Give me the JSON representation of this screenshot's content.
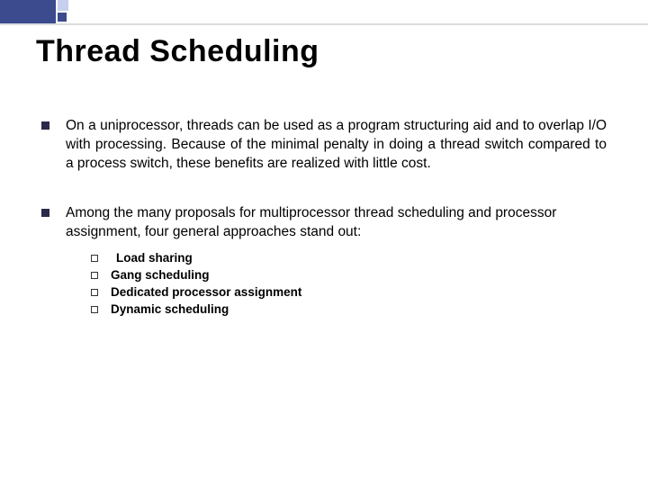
{
  "title": "Thread Scheduling",
  "bullets": [
    {
      "text": "On a uniprocessor, threads can be used as a program structuring aid and to overlap I/O with processing. Because of the minimal penalty in doing a thread switch compared to a process switch, these benefits are realized with little cost."
    },
    {
      "text": "Among the many proposals for multiprocessor thread scheduling and processor assignment, four general approaches stand out:",
      "sub": [
        "Load sharing",
        "Gang scheduling",
        "Dedicated processor assignment",
        "Dynamic scheduling"
      ]
    }
  ]
}
